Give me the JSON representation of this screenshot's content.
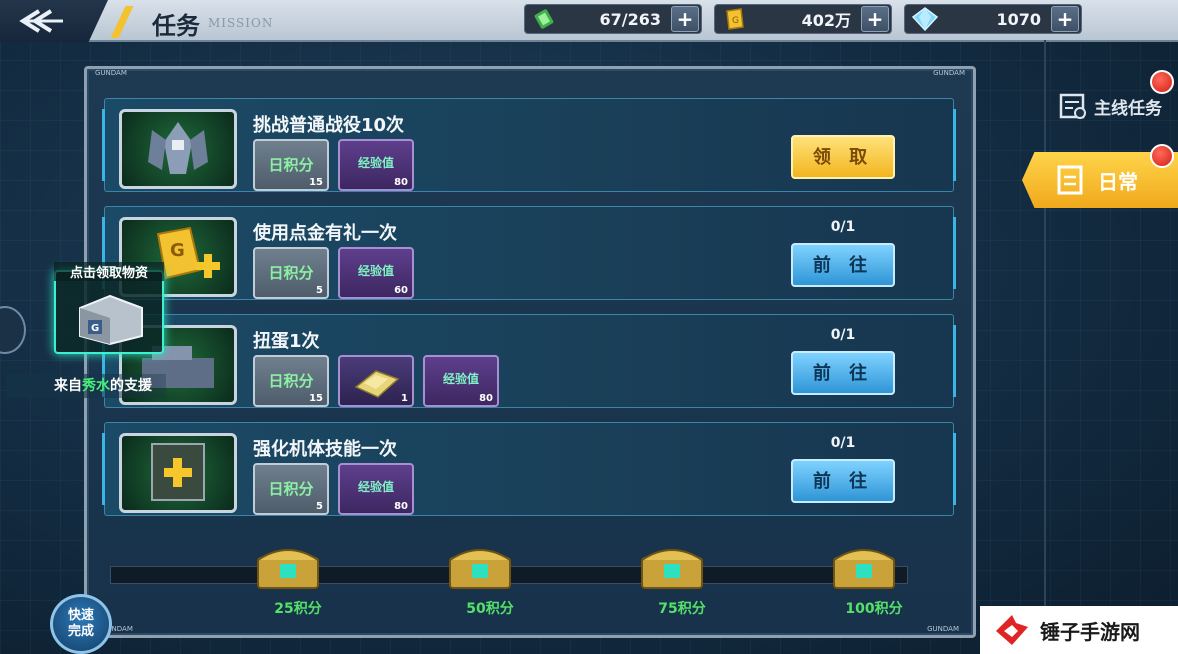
{
  "header": {
    "title": "任务",
    "subtitle": "MISSION"
  },
  "resources": [
    {
      "icon": "energy-icon",
      "value": "67/263"
    },
    {
      "icon": "gold-bar-icon",
      "value": "402万"
    },
    {
      "icon": "diamond-icon",
      "value": "1070"
    }
  ],
  "tasks": [
    {
      "title": "挑战普通战役10次",
      "daily_label": "日积分",
      "daily_points": "15",
      "exp_label": "经验值",
      "exp_points": "80",
      "action": "领 取",
      "progress": ""
    },
    {
      "title": "使用点金有礼一次",
      "daily_label": "日积分",
      "daily_points": "5",
      "exp_label": "经验值",
      "exp_points": "60",
      "action": "前 往",
      "progress": "0/1"
    },
    {
      "title": "扭蛋1次",
      "daily_label": "日积分",
      "daily_points": "15",
      "item_count": "1",
      "exp_label": "经验值",
      "exp_points": "80",
      "action": "前 往",
      "progress": "0/1"
    },
    {
      "title": "强化机体技能一次",
      "daily_label": "日积分",
      "daily_points": "5",
      "exp_label": "经验值",
      "exp_points": "80",
      "action": "前 往",
      "progress": "0/1"
    }
  ],
  "rewards": [
    {
      "label": "25积分"
    },
    {
      "label": "50积分"
    },
    {
      "label": "75积分"
    },
    {
      "label": "100积分"
    }
  ],
  "side_tabs": {
    "main": "主线任务",
    "daily": "日常"
  },
  "notification": {
    "title": "点击领取物资",
    "support_prefix": "来自",
    "support_name": "秀水",
    "support_suffix": "的支援"
  },
  "quick_complete": {
    "line1": "快速",
    "line2": "完成"
  },
  "panel_tags": {
    "tl": "GUNDAM",
    "tr": "GUNDAM",
    "bl": "GUNDAM",
    "br": "GUNDAM"
  },
  "watermark": "锤子手游网",
  "colors": {
    "accent_gold": "#f2b51f",
    "accent_blue": "#2f95d6",
    "points_green": "#55e06a",
    "notif_cyan": "#3ff0d0",
    "badge_red": "#d41f16"
  }
}
